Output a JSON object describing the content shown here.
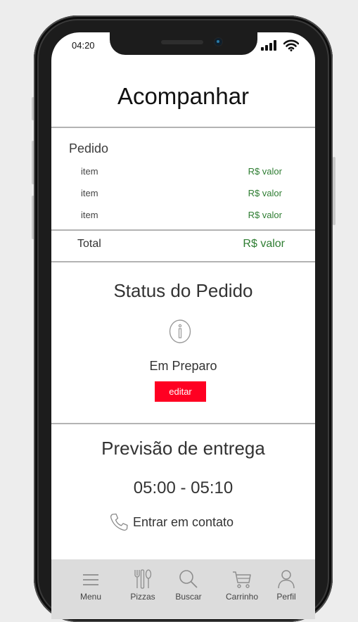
{
  "status_bar": {
    "time": "04:20"
  },
  "page": {
    "title": "Acompanhar"
  },
  "order": {
    "section_label": "Pedido",
    "items": [
      {
        "name": "item",
        "price": "R$ valor"
      },
      {
        "name": "item",
        "price": "R$ valor"
      },
      {
        "name": "item",
        "price": "R$ valor"
      }
    ],
    "total_label": "Total",
    "total_price": "R$ valor"
  },
  "status": {
    "heading": "Status do Pedido",
    "icon": "info-icon",
    "value": "Em Preparo",
    "edit_label": "editar",
    "edit_color": "#ff0022"
  },
  "delivery": {
    "heading": "Previsão de entrega",
    "time_range": "05:00 - 05:10",
    "contact_label": "Entrar em contato",
    "contact_icon": "phone-icon"
  },
  "tabbar": {
    "items": [
      {
        "label": "Menu",
        "icon": "menu-icon"
      },
      {
        "label": "Pizzas",
        "icon": "utensils-icon"
      },
      {
        "label": "Buscar",
        "icon": "search-icon"
      },
      {
        "label": "Carrinho",
        "icon": "cart-icon"
      },
      {
        "label": "Perfil",
        "icon": "user-icon"
      }
    ]
  },
  "colors": {
    "price_green": "#2e7d32",
    "tabbar_bg": "#dcdcdc"
  }
}
